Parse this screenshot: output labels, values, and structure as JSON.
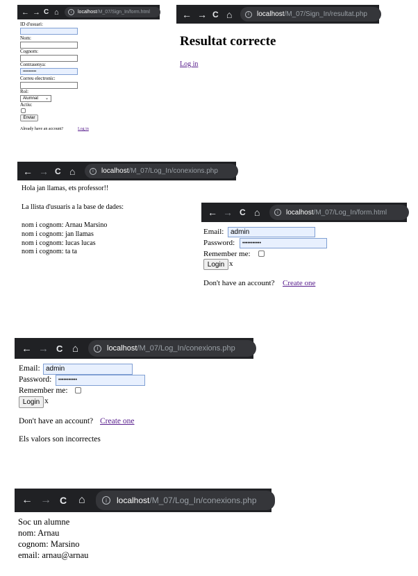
{
  "nav_icons": {
    "back": "←",
    "forward": "→",
    "reload": "C",
    "home": "⌂",
    "info": "i"
  },
  "s1": {
    "url_host": "localhost",
    "url_path": "/M_07/Sign_In/form.html",
    "id_label": "ID d'usuari:",
    "nom_label": "Nom:",
    "cognom_label": "Cognom:",
    "password_label": "Contrasenya:",
    "password_value": "•••••••••••",
    "email_label": "Correu electronic:",
    "rol_label": "Rol:",
    "rol_value": "Alumnat",
    "actiu_label": "Actiu:",
    "submit": "Enviar",
    "already_text": "Already have an account?",
    "login_link": "Log in"
  },
  "s2": {
    "url_host": "localhost",
    "url_path": "/M_07/Sign_In/resultat.php",
    "heading": "Resultat correcte",
    "login_link": "Log in"
  },
  "s3": {
    "url_host": "localhost",
    "url_path": "/M_07/Log_In/conexions.php",
    "greeting": "Hola jan llamas, ets professor!!",
    "list_intro": "La llista d'usuaris a la base de dades:",
    "users": [
      "nom i cognom: Arnau Marsino",
      "nom i cognom: jan llamas",
      "nom i cognom: lucas lucas",
      "nom i cognom: ta ta"
    ]
  },
  "s4": {
    "url_host": "localhost",
    "url_path": "/M_07/Log_In/form.html",
    "email_label": "Email:",
    "email_value": "admin",
    "password_label": "Password:",
    "password_value": "•••••••••••",
    "remember_label": "Remember me:",
    "login_button": "Login",
    "x_text": "x",
    "no_account_text": "Don't have an account?",
    "create_link": "Create one"
  },
  "s5": {
    "url_host": "localhost",
    "url_path": "/M_07/Log_In/conexions.php",
    "email_label": "Email:",
    "email_value": "admin",
    "password_label": "Password:",
    "password_value": "•••••••••••",
    "remember_label": "Remember me:",
    "login_button": "Login",
    "x_text": "x",
    "no_account_text": "Don't have an account?",
    "create_link": "Create one",
    "error_text": "Els valors son incorrectes"
  },
  "s6": {
    "url_host": "localhost",
    "url_path": "/M_07/Log_In/conexions.php",
    "line1": "Soc un alumne",
    "line2": "nom: Arnau",
    "line3": "cognom: Marsino",
    "line4": "email: arnau@arnau"
  }
}
